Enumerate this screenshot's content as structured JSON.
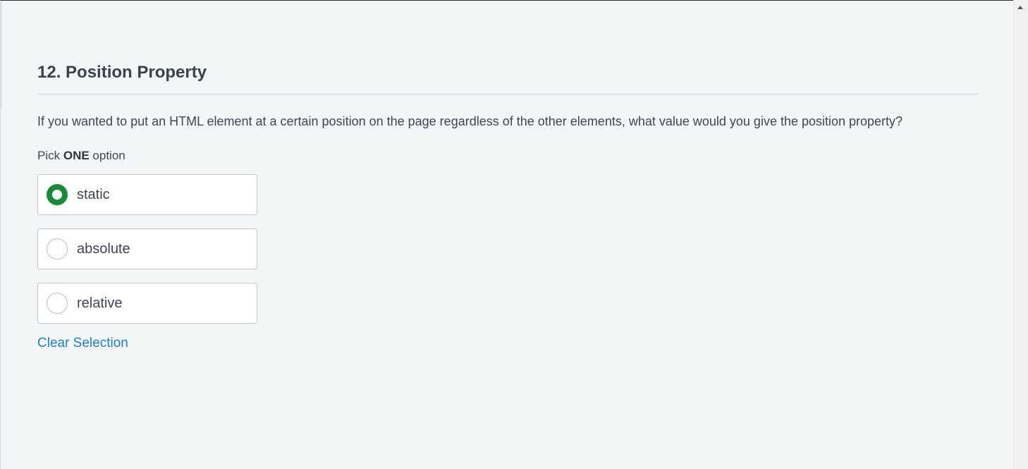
{
  "question": {
    "title": "12. Position Property",
    "text": "If you wanted to put an HTML element at a certain position on the page regardless of the other elements, what value would you give the position property?",
    "instruction_prefix": "Pick ",
    "instruction_emphasis": "ONE",
    "instruction_suffix": " option"
  },
  "options": [
    {
      "label": "static",
      "selected": true
    },
    {
      "label": "absolute",
      "selected": false
    },
    {
      "label": "relative",
      "selected": false
    }
  ],
  "clear_label": "Clear Selection",
  "colors": {
    "accent_green": "#1a8a3a",
    "link_blue": "#1e7ec2",
    "text": "#3d4654",
    "background": "#f3f6f7"
  }
}
